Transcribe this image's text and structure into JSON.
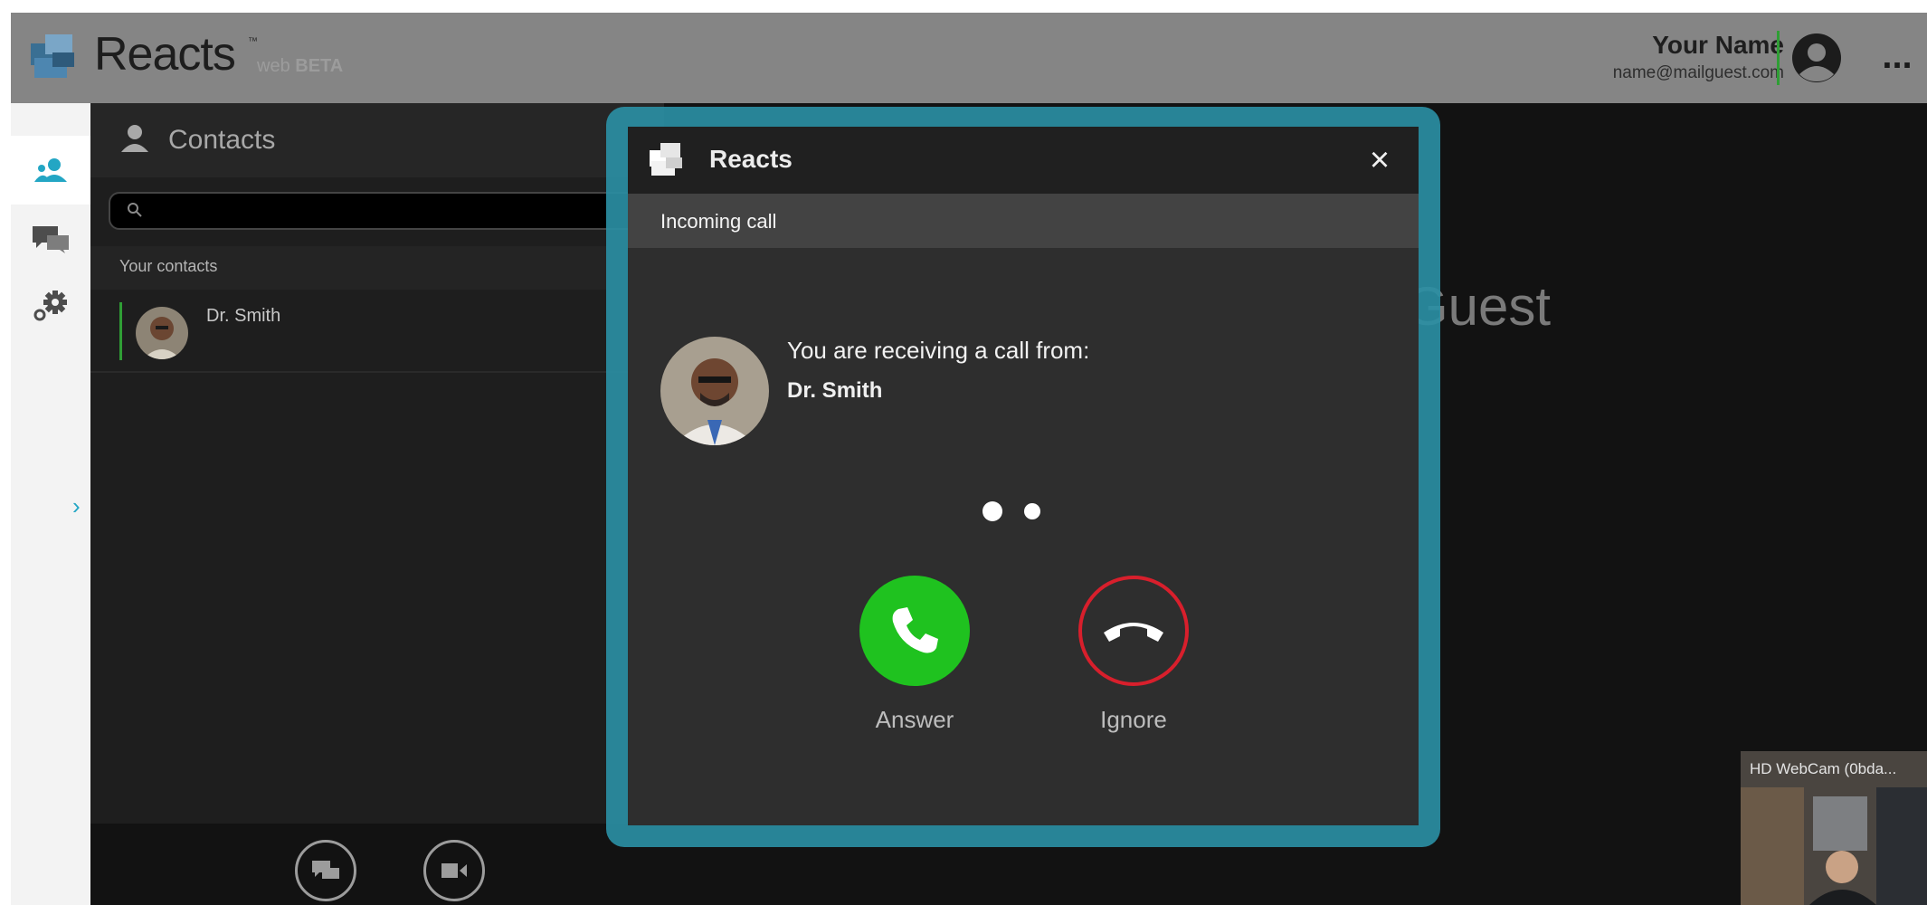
{
  "app": {
    "brand": "Reacts",
    "trademark": "™",
    "edition": "web",
    "beta": "BETA"
  },
  "user": {
    "name": "Your Name",
    "email": "name@mailguest.com"
  },
  "header": {
    "more_label": "..."
  },
  "sidebar": {
    "items": [
      {
        "icon": "contacts-icon",
        "active": true
      },
      {
        "icon": "chat-icon",
        "active": false
      },
      {
        "icon": "settings-icon",
        "active": false
      }
    ],
    "expand_label": "›"
  },
  "contacts": {
    "title": "Contacts",
    "search_placeholder": "",
    "section": "Your contacts",
    "items": [
      {
        "name": "Dr. Smith"
      }
    ]
  },
  "main": {
    "guest_text": "Guest",
    "webcam_label": "HD WebCam (0bda..."
  },
  "dialog": {
    "title": "Reacts",
    "close_label": "×",
    "subtitle": "Incoming call",
    "message": "You are receiving a call from:",
    "caller": "Dr. Smith",
    "answer_label": "Answer",
    "ignore_label": "Ignore"
  },
  "colors": {
    "accent_teal": "#2a8ea3",
    "answer_green": "#1fc21f",
    "ignore_red": "#d81f2c",
    "online_green": "#2f9e35"
  }
}
